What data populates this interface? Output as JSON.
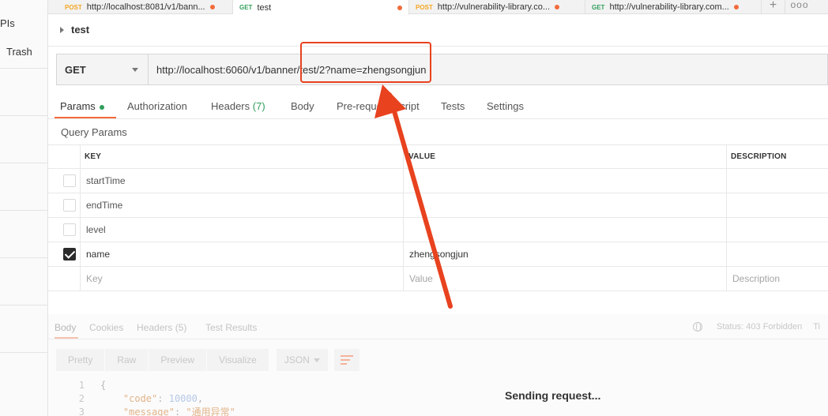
{
  "sidebar": {
    "top_label": "PIs",
    "trash_label": "Trash"
  },
  "tabs": [
    {
      "method": "POST",
      "label": "http://localhost:8081/v1/bann...",
      "active": false,
      "unsaved": true
    },
    {
      "method": "GET",
      "label": "test",
      "active": true,
      "unsaved": true
    },
    {
      "method": "POST",
      "label": "http://vulnerability-library.co...",
      "active": false,
      "unsaved": true
    },
    {
      "method": "GET",
      "label": "http://vulnerability-library.com...",
      "active": false,
      "unsaved": true
    }
  ],
  "tab_controls": {
    "add": "+",
    "more": "ooo"
  },
  "request": {
    "title": "test",
    "method": "GET",
    "url": "http://localhost:6060/v1/banner/test/2?name=zhengsongjun"
  },
  "request_tabs": {
    "params": "Params",
    "authorization": "Authorization",
    "headers": "Headers",
    "headers_count": "(7)",
    "body": "Body",
    "prerequest": "Pre-request Script",
    "tests": "Tests",
    "settings": "Settings"
  },
  "query_params": {
    "label": "Query Params",
    "columns": {
      "key": "KEY",
      "value": "VALUE",
      "description": "DESCRIPTION"
    },
    "rows": [
      {
        "key": "startTime",
        "value": "",
        "description": "",
        "checked": false
      },
      {
        "key": "endTime",
        "value": "",
        "description": "",
        "checked": false
      },
      {
        "key": "level",
        "value": "",
        "description": "",
        "checked": false
      },
      {
        "key": "name",
        "value": "zhengsongjun",
        "description": "",
        "checked": true
      }
    ],
    "placeholders": {
      "key": "Key",
      "value": "Value",
      "description": "Description"
    }
  },
  "response": {
    "tabs": {
      "body": "Body",
      "cookies": "Cookies",
      "headers": "Headers",
      "headers_count": "(5)",
      "test_results": "Test Results"
    },
    "status": "Status: 403 Forbidden",
    "status_more": "Ti",
    "format_buttons": {
      "pretty": "Pretty",
      "raw": "Raw",
      "preview": "Preview",
      "visualize": "Visualize"
    },
    "format_select": "JSON",
    "code": {
      "line1": "1",
      "line2": "2",
      "line3": "3",
      "open_brace": "{",
      "code_key": "\"code\"",
      "code_value": "10000",
      "message_key": "\"message\"",
      "message_value": "\"通用异常\""
    },
    "sending_text": "Sending request..."
  },
  "colors": {
    "accent": "#f26b3a",
    "get": "#2f9e5b",
    "post": "#f5a623",
    "annotation": "#e8421f"
  },
  "icons": [
    "caret-right-icon",
    "chevron-down-icon",
    "globe-icon",
    "wrap-lines-icon",
    "checkbox-checked-icon",
    "plus-icon",
    "more-icon"
  ]
}
